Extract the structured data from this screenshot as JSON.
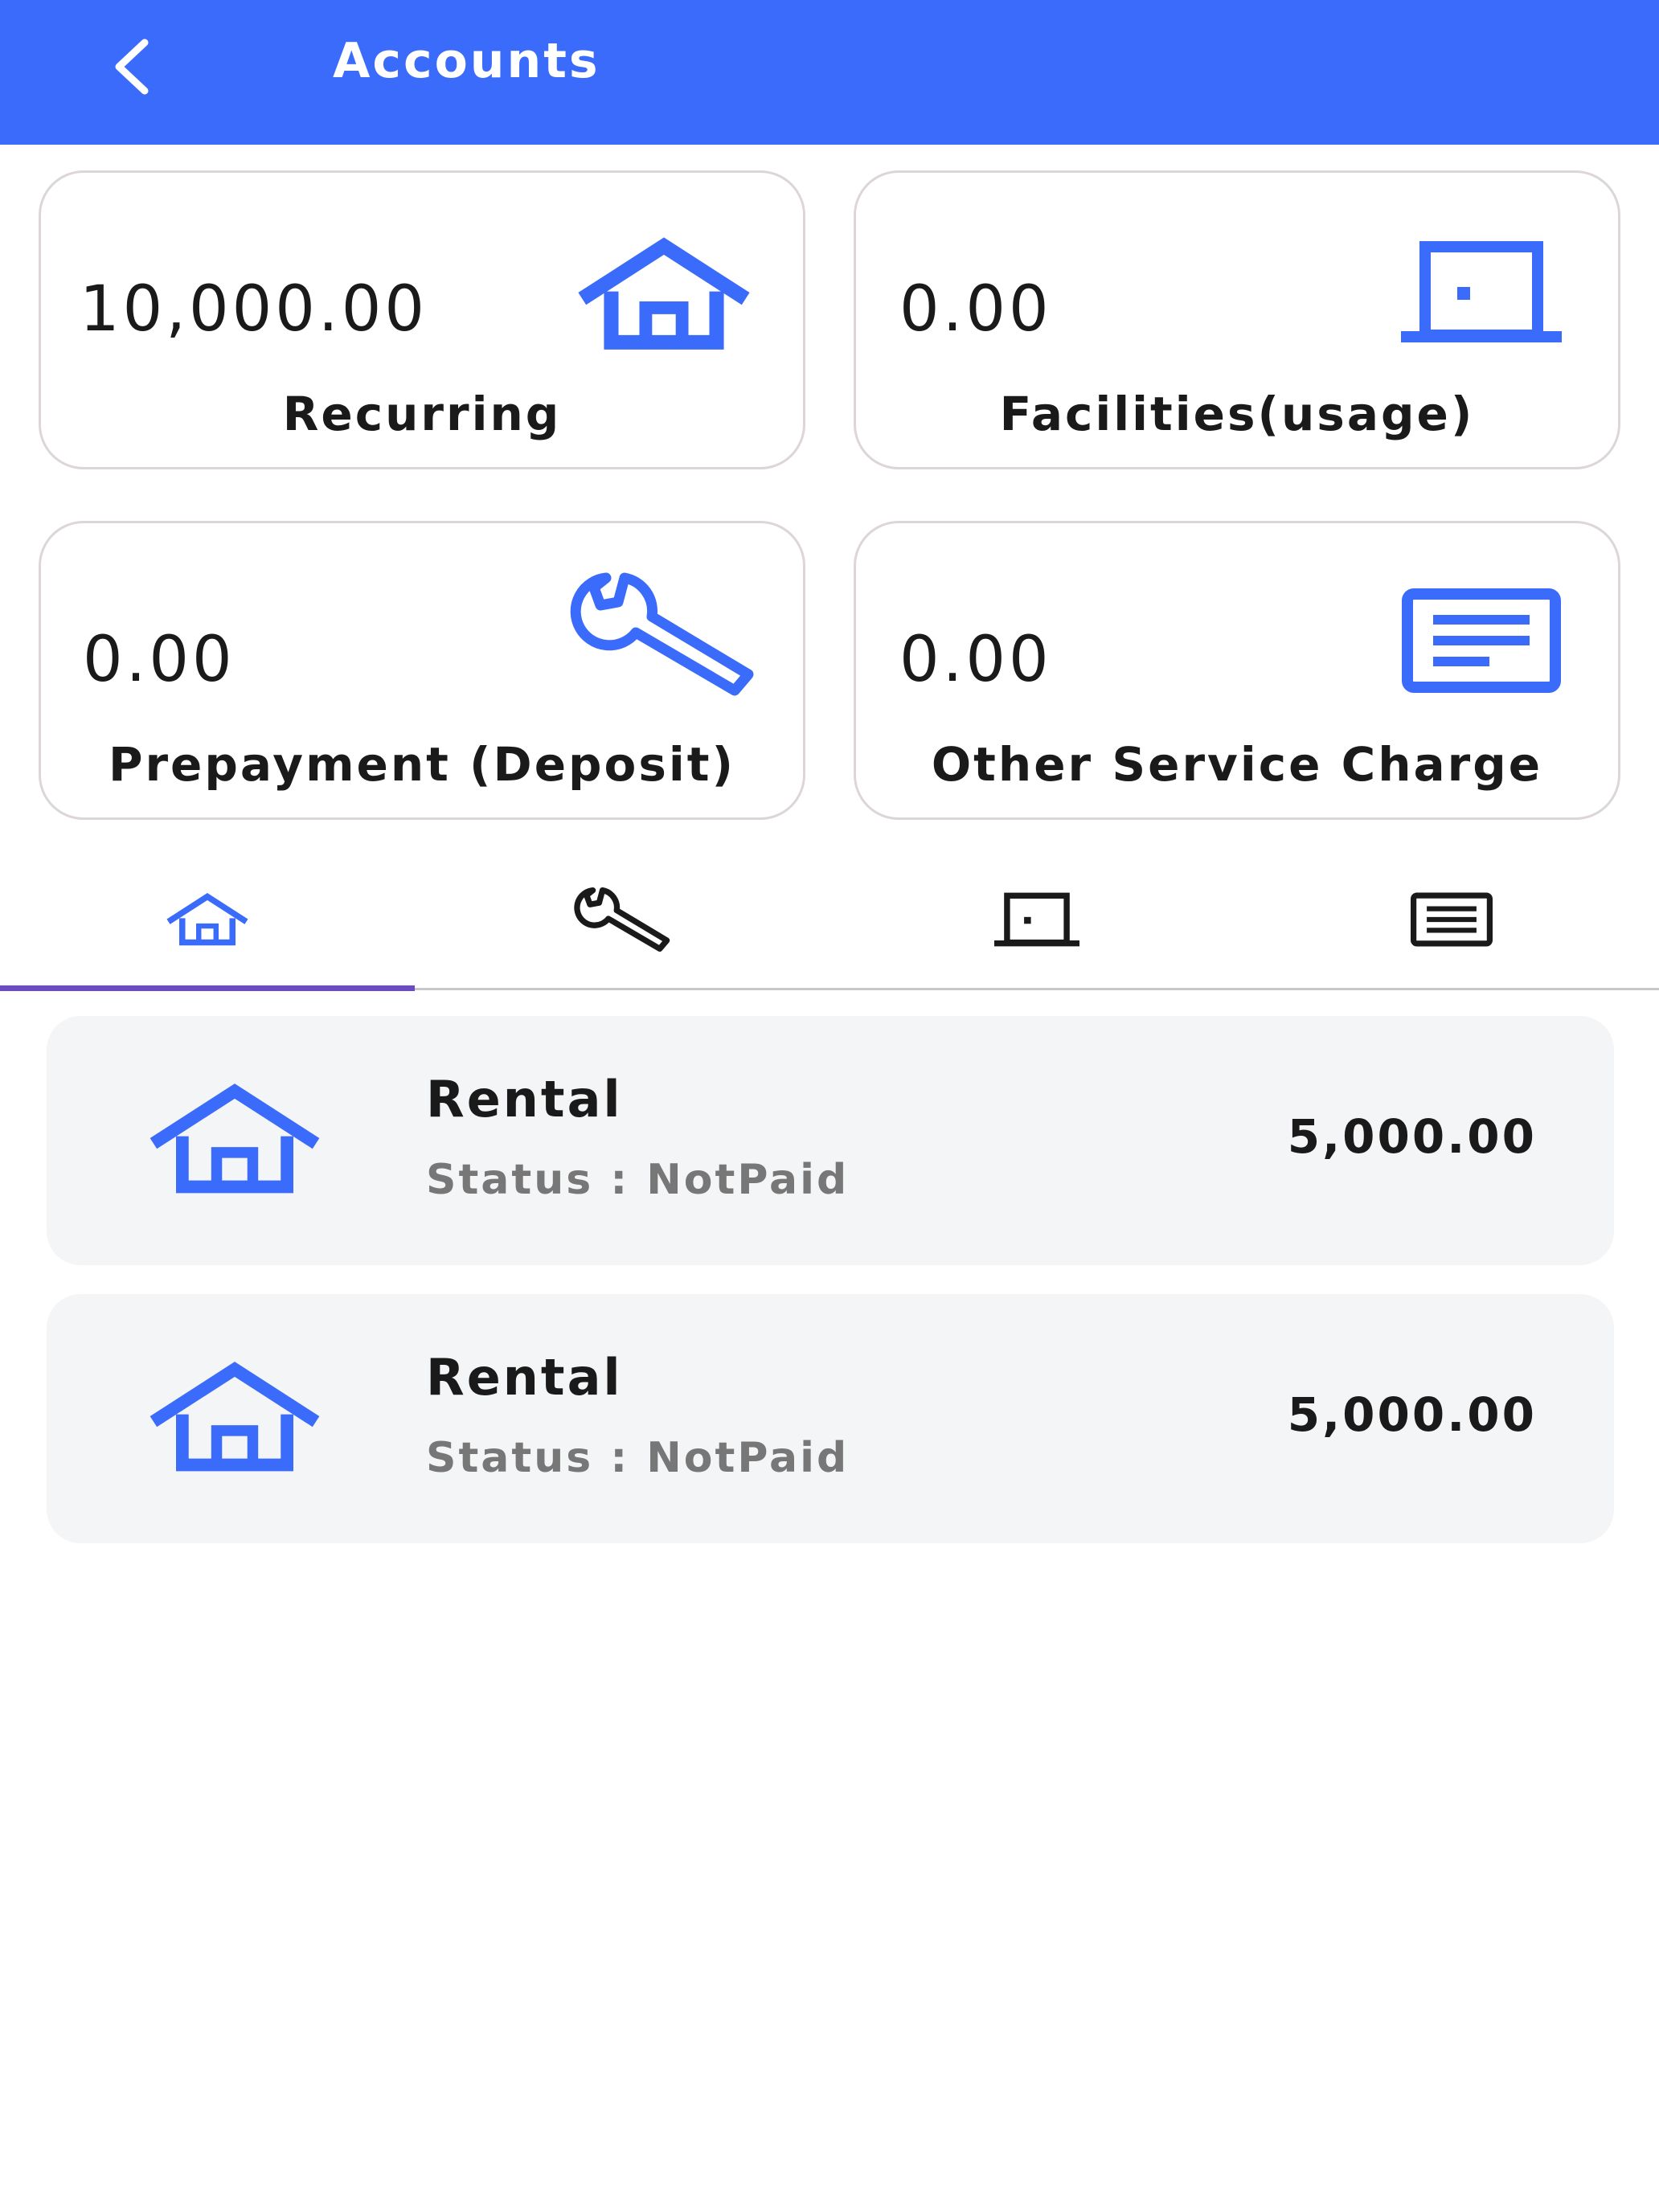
{
  "header": {
    "title": "Accounts",
    "back_icon": "chevron-left-icon",
    "background_color": "#3b6bfa"
  },
  "summary_cards": [
    {
      "amount": "10,000.00",
      "label": "Recurring",
      "icon": "home-icon"
    },
    {
      "amount": "0.00",
      "label": "Facilities(usage)",
      "icon": "door-icon"
    },
    {
      "amount": "0.00",
      "label": "Prepayment (Deposit)",
      "icon": "wrench-icon"
    },
    {
      "amount": "0.00",
      "label": "Other Service Charge",
      "icon": "document-icon"
    }
  ],
  "tabs": [
    {
      "icon": "home-icon",
      "selected": true
    },
    {
      "icon": "wrench-icon",
      "selected": false
    },
    {
      "icon": "door-icon",
      "selected": false
    },
    {
      "icon": "document-icon",
      "selected": false
    }
  ],
  "transactions": [
    {
      "title": "Rental",
      "status": "Status : NotPaid",
      "amount": "5,000.00",
      "icon": "home-icon"
    },
    {
      "title": "Rental",
      "status": "Status : NotPaid",
      "amount": "5,000.00",
      "icon": "home-icon"
    }
  ],
  "colors": {
    "accent": "#3b6bfa",
    "tab_indicator": "#6a4bc4",
    "status_text": "#777777"
  }
}
